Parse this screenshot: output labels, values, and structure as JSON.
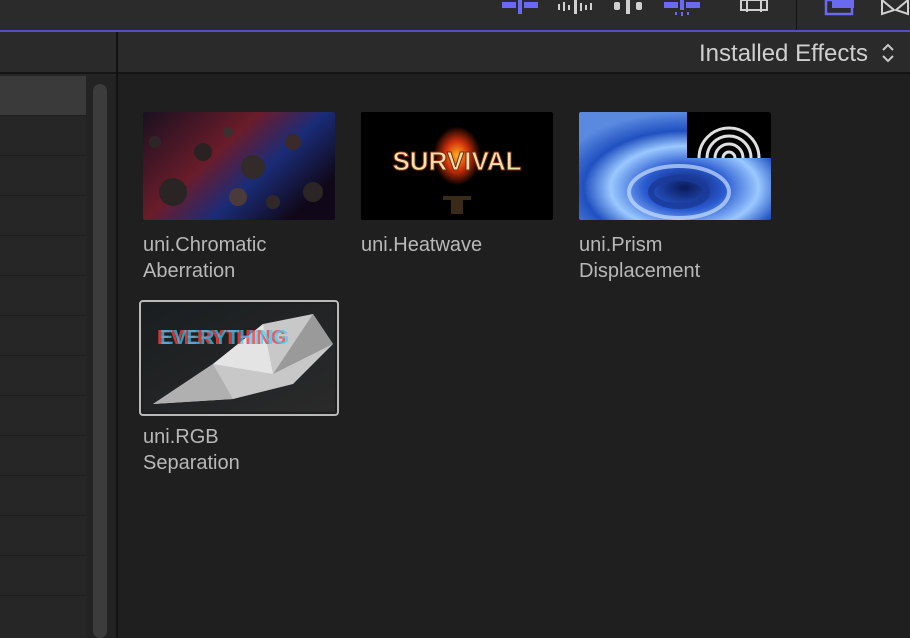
{
  "browser": {
    "title": "Installed Effects"
  },
  "effects": [
    {
      "name": "uni.Chromatic\nAberration",
      "thumbnail_text": ""
    },
    {
      "name": "uni.Heatwave",
      "thumbnail_text": "SURVIVAL"
    },
    {
      "name": "uni.Prism\nDisplacement",
      "thumbnail_text": ""
    },
    {
      "name": "uni.RGB\nSeparation",
      "thumbnail_text": "EVERYTHING"
    }
  ],
  "colors": {
    "accent": "#4f4fc8",
    "toolbar_icon_active": "#6a6af0",
    "toolbar_icon": "#d0d0d0",
    "selection_border": "#b9b9b9"
  },
  "icons": [
    "audio-skim-icon",
    "waveform-icon",
    "solo-icon",
    "snapping-icon",
    "filmstrip-icon",
    "browser-toggle-icon",
    "transitions-icon",
    "updown-chevron-icon"
  ]
}
